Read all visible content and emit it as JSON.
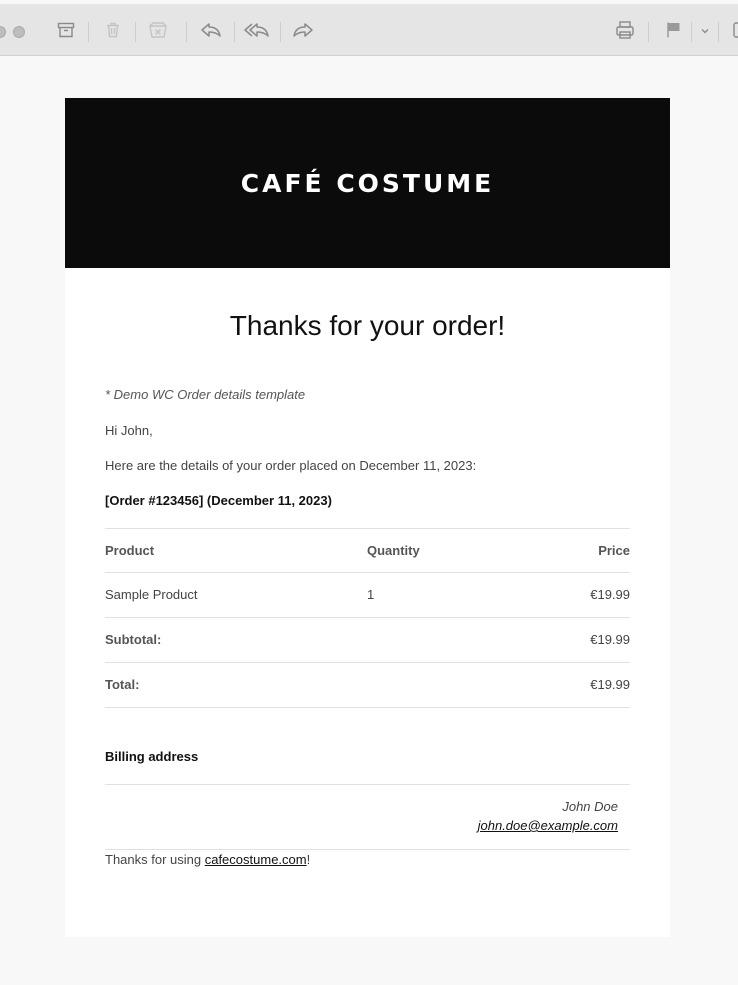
{
  "toolbar": {
    "icons": [
      "archive-icon",
      "trash-icon",
      "junk-icon",
      "reply-icon",
      "reply-all-icon",
      "forward-icon",
      "print-icon",
      "flag-icon",
      "chevron-down-icon",
      "panel-icon"
    ]
  },
  "email": {
    "brand": "CAFÉ COSTUME",
    "heading": "Thanks for your order!",
    "template_note": "* Demo WC Order details template",
    "greeting": "Hi John,",
    "intro": "Here are the details of your order placed on December 11, 2023:",
    "order_ref": "[Order #123456] (December 11, 2023)",
    "table": {
      "headers": {
        "product": "Product",
        "quantity": "Quantity",
        "price": "Price"
      },
      "rows": [
        {
          "product": "Sample Product",
          "quantity": "1",
          "price": "€19.99"
        }
      ],
      "subtotal_label": "Subtotal:",
      "subtotal_value": "€19.99",
      "total_label": "Total:",
      "total_value": "€19.99"
    },
    "billing": {
      "title": "Billing address",
      "name": "John Doe",
      "email": "john.doe@example.com"
    },
    "footer": {
      "prefix": "Thanks for using ",
      "link": "cafecostume.com",
      "suffix": "!"
    }
  },
  "colors": {
    "banner_bg": "#0b0b0b",
    "toolbar_bg": "#e5e5e5",
    "page_bg": "#f8f8f8"
  }
}
